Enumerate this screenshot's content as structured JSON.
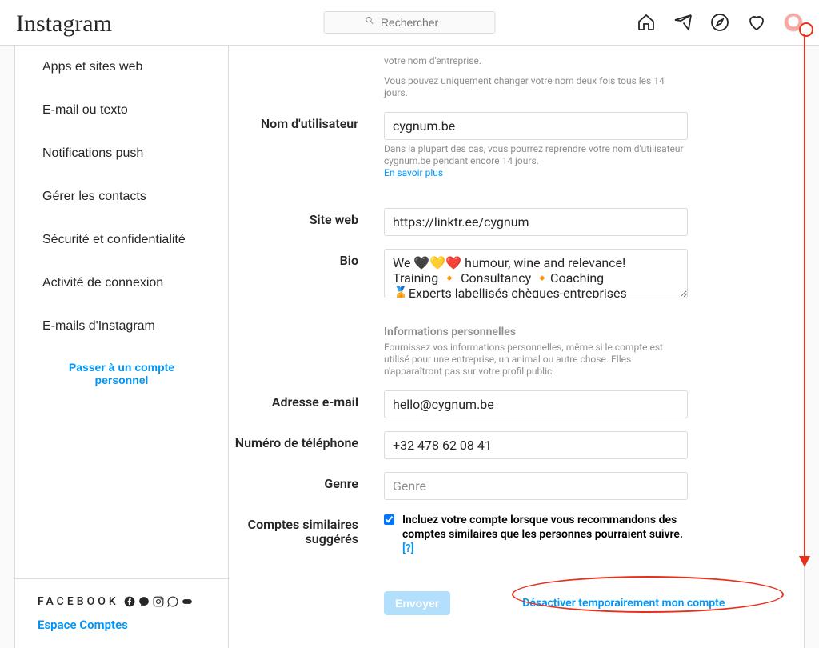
{
  "header": {
    "brand": "Instagram",
    "search_placeholder": "Rechercher"
  },
  "sidebar": {
    "items": [
      {
        "label": "Apps et sites web"
      },
      {
        "label": "E-mail ou texto"
      },
      {
        "label": "Notifications push"
      },
      {
        "label": "Gérer les contacts"
      },
      {
        "label": "Sécurité et confidentialité"
      },
      {
        "label": "Activité de connexion"
      },
      {
        "label": "E-mails d'Instagram"
      }
    ],
    "switch_label": "Passer à un compte personnel",
    "footer_brand": "FACEBOOK",
    "footer_link": "Espace Comptes"
  },
  "form": {
    "name_hint1": "votre nom d'entreprise.",
    "name_hint2": "Vous pouvez uniquement changer votre nom deux fois tous les 14 jours.",
    "username_label": "Nom d'utilisateur",
    "username_value": "cygnum.be",
    "username_hint": "Dans la plupart des cas, vous pourrez reprendre votre nom d'utilisateur cygnum.be pendant encore 14 jours.",
    "learn_more": "En savoir plus",
    "website_label": "Site web",
    "website_value": "https://linktr.ee/cygnum",
    "bio_label": "Bio",
    "bio_value": "We 🖤💛❤️ humour, wine and relevance!\nTraining 🔸 Consultancy 🔸Coaching\n🏅Experts labellisés chèques-entreprises",
    "personal_header": "Informations personnelles",
    "personal_hint": "Fournissez vos informations personnelles, même si le compte est utilisé pour une entreprise, un animal ou autre chose. Elles n'apparaîtront pas sur votre profil public.",
    "email_label": "Adresse e-mail",
    "email_value": "hello@cygnum.be",
    "phone_label": "Numéro de téléphone",
    "phone_value": "+32 478 62 08 41",
    "gender_label": "Genre",
    "gender_placeholder": "Genre",
    "similar_label": "Comptes similaires suggérés",
    "similar_checkbox": "Incluez votre compte lorsque vous recommandons des comptes similaires que les personnes pourraient suivre.",
    "similar_help": "[?]",
    "submit": "Envoyer",
    "deactivate": "Désactiver temporairement mon compte"
  }
}
